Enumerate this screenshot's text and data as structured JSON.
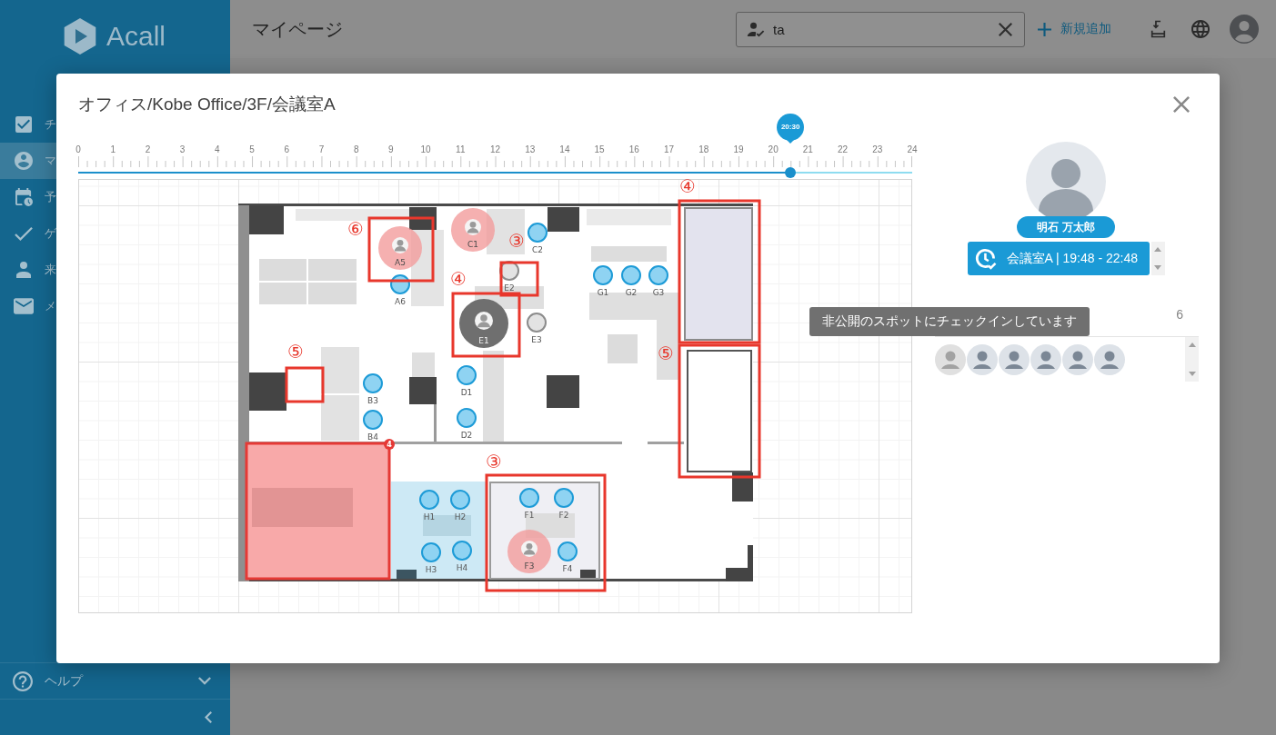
{
  "sidebar": {
    "logo": "Acall",
    "items": [
      {
        "label": "チ",
        "selected": false
      },
      {
        "label": "マ",
        "selected": true
      },
      {
        "label": "予",
        "selected": false
      },
      {
        "label": "ゲ",
        "selected": false
      },
      {
        "label": "来",
        "selected": false
      },
      {
        "label": "メ",
        "selected": false
      }
    ],
    "help": "ヘルプ"
  },
  "header": {
    "title": "マイページ",
    "search": {
      "value": "ta"
    },
    "add_button": "新規追加"
  },
  "dialog": {
    "title": "オフィス/Kobe Office/3F/会議室A",
    "timeline": {
      "ticks": [
        "0",
        "1",
        "2",
        "3",
        "4",
        "5",
        "6",
        "7",
        "8",
        "9",
        "10",
        "11",
        "12",
        "13",
        "14",
        "15",
        "16",
        "17",
        "18",
        "19",
        "20",
        "21",
        "22",
        "23",
        "24"
      ],
      "current": "20:30",
      "level": 0.854
    },
    "floor_plan": {
      "seats": [
        {
          "label": "A5",
          "kind": "occupied"
        },
        {
          "label": "C1",
          "kind": "occupied"
        },
        {
          "label": "C2",
          "kind": "available"
        },
        {
          "label": "E2",
          "kind": "unavailable"
        },
        {
          "label": "G1",
          "kind": "available"
        },
        {
          "label": "G2",
          "kind": "available"
        },
        {
          "label": "G3",
          "kind": "available"
        },
        {
          "label": "A6",
          "kind": "available"
        },
        {
          "label": "E1",
          "kind": "private"
        },
        {
          "label": "E3",
          "kind": "unavailable"
        },
        {
          "label": "D1",
          "kind": "available"
        },
        {
          "label": "B3",
          "kind": "available"
        },
        {
          "label": "B4",
          "kind": "available"
        },
        {
          "label": "D2",
          "kind": "available"
        },
        {
          "label": "H1",
          "kind": "available"
        },
        {
          "label": "H2",
          "kind": "available"
        },
        {
          "label": "F1",
          "kind": "available"
        },
        {
          "label": "F2",
          "kind": "available"
        },
        {
          "label": "H3",
          "kind": "available"
        },
        {
          "label": "H4",
          "kind": "available"
        },
        {
          "label": "F3",
          "kind": "occupied"
        },
        {
          "label": "F4",
          "kind": "available"
        }
      ],
      "room_badge": "4",
      "annotations": [
        {
          "label": "⑥"
        },
        {
          "label": "③"
        },
        {
          "label": "④"
        },
        {
          "label": "⑤"
        },
        {
          "label": "④"
        },
        {
          "label": "⑤"
        },
        {
          "label": "③"
        }
      ]
    },
    "tooltip": "非公開のスポットにチェックインしています",
    "person": {
      "name": "明石 万太郎",
      "booking": "会議室A | 19:48 - 22:48"
    },
    "checkins": {
      "count": "6",
      "people": [
        {
          "kind": "default"
        },
        {
          "kind": "photo"
        },
        {
          "kind": "photo"
        },
        {
          "kind": "photo"
        },
        {
          "kind": "photo"
        },
        {
          "kind": "photo"
        }
      ]
    }
  }
}
